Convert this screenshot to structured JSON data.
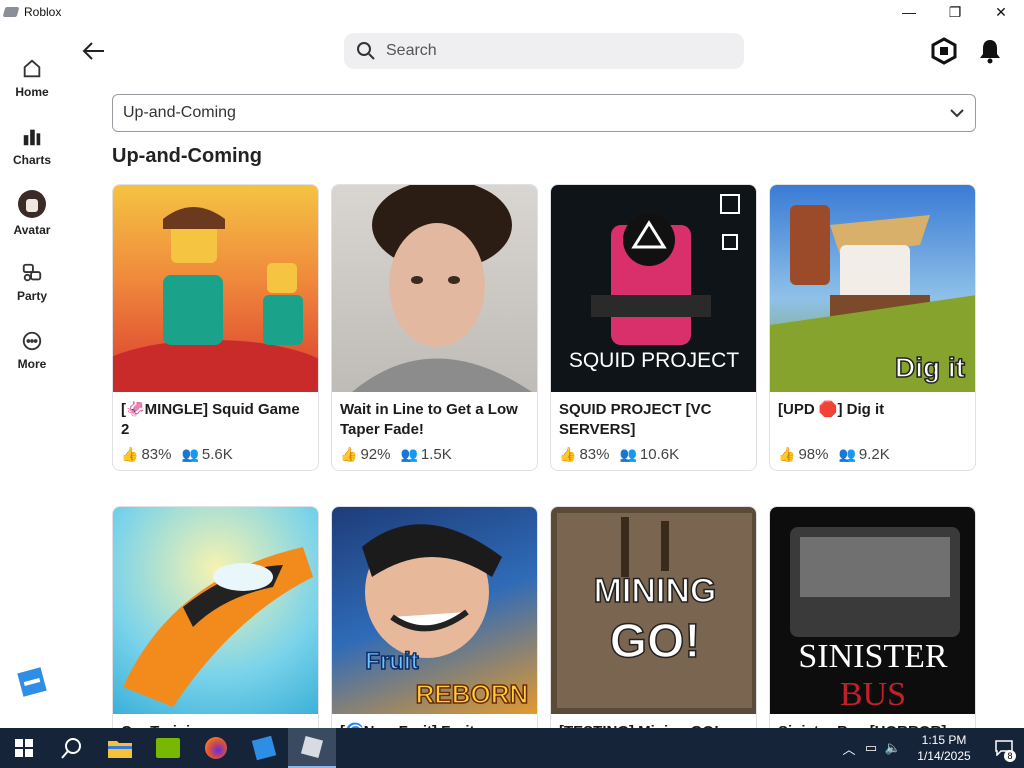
{
  "window": {
    "title": "Roblox",
    "minimize": "—",
    "restore": "❐",
    "close": "✕"
  },
  "sidebar": {
    "items": [
      {
        "label": "Home",
        "icon": "home-icon"
      },
      {
        "label": "Charts",
        "icon": "charts-icon"
      },
      {
        "label": "Avatar",
        "icon": "avatar-icon"
      },
      {
        "label": "Party",
        "icon": "party-icon"
      },
      {
        "label": "More",
        "icon": "more-icon"
      }
    ]
  },
  "header": {
    "search_placeholder": "Search"
  },
  "filter": {
    "selected": "Up-and-Coming"
  },
  "section": {
    "title": "Up-and-Coming"
  },
  "games": [
    {
      "title": "[🦑MINGLE] Squid Game 2",
      "rating": "83%",
      "players": "5.6K"
    },
    {
      "title": "Wait in Line to Get a Low Taper Fade!",
      "rating": "92%",
      "players": "1.5K"
    },
    {
      "title": "SQUID PROJECT [VC SERVERS]",
      "rating": "83%",
      "players": "10.6K"
    },
    {
      "title": "[UPD 🛑] Dig it",
      "rating": "98%",
      "players": "9.2K"
    },
    {
      "title": "Car Training",
      "rating": "",
      "players": ""
    },
    {
      "title": "[🌀New Fruit] Fruit Reborn",
      "rating": "",
      "players": ""
    },
    {
      "title": "[TESTING] Mining GO!",
      "rating": "",
      "players": ""
    },
    {
      "title": "Sinister Bus [HORROR]",
      "rating": "",
      "players": ""
    }
  ],
  "thumb_text": {
    "squid_project": "SQUID PROJECT",
    "dig_it": "Dig it",
    "fruit": "Fruit",
    "reborn": "REBORN",
    "mining": "MINING",
    "go": "GO!",
    "sinister": "SINISTER",
    "bus": "BUS"
  },
  "taskbar": {
    "time": "1:15 PM",
    "date": "1/14/2025",
    "notification_count": "8"
  }
}
